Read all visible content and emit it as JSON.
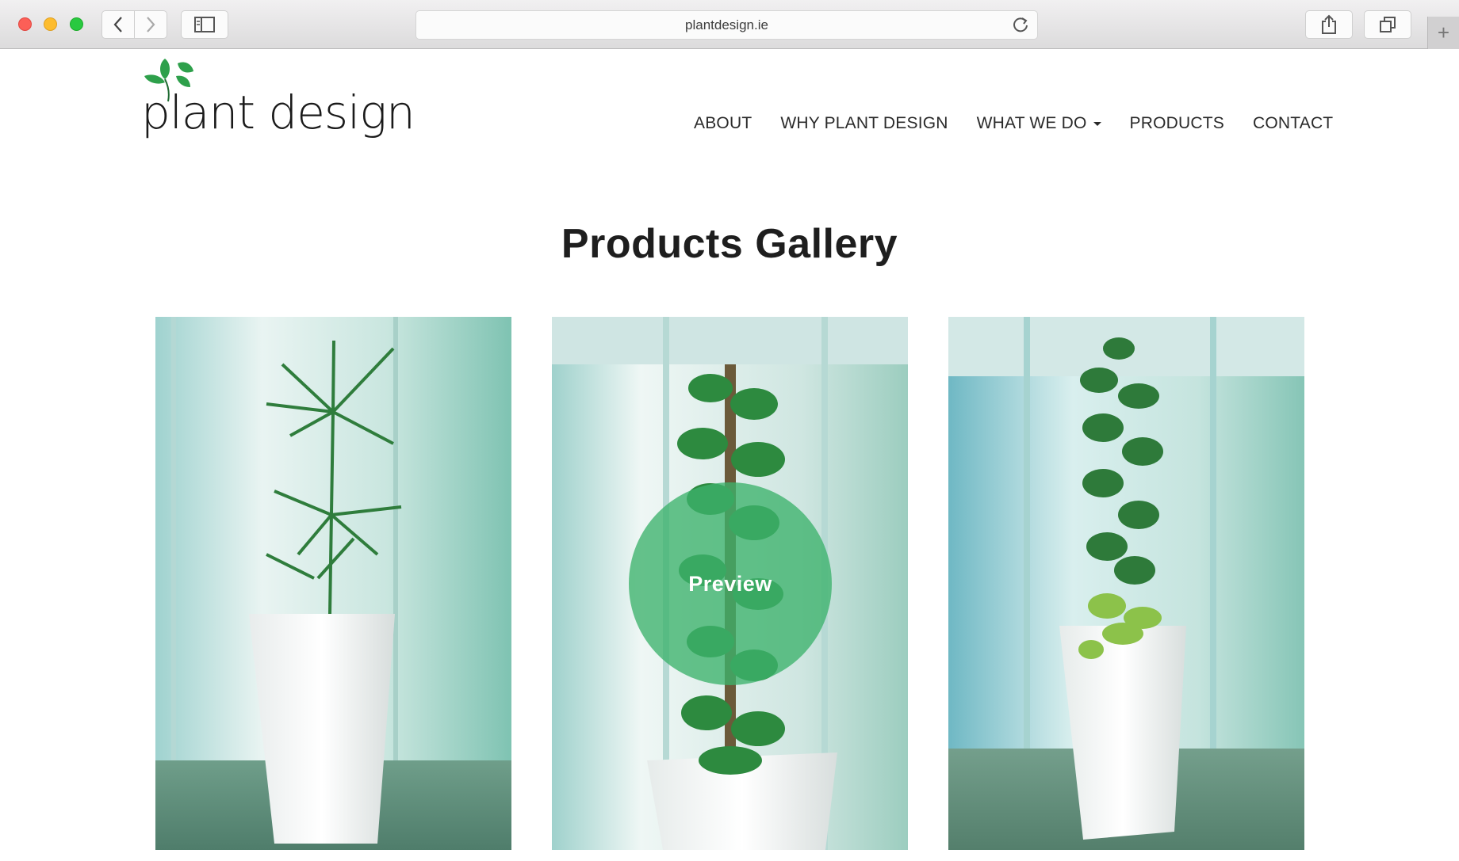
{
  "browser": {
    "url": "plantdesign.ie",
    "icons": {
      "back": "chevron-left-icon",
      "forward": "chevron-right-icon",
      "sidebar": "sidebar-icon",
      "reload": "reload-icon",
      "share": "share-icon",
      "tabs": "tabs-icon",
      "new_tab": "plus-icon"
    }
  },
  "site": {
    "logo_text": "plant design",
    "brand_color": "#2ea04b",
    "nav": [
      {
        "label": "ABOUT"
      },
      {
        "label": "WHY PLANT DESIGN"
      },
      {
        "label": "WHAT WE DO",
        "has_dropdown": true
      },
      {
        "label": "PRODUCTS"
      },
      {
        "label": "CONTACT"
      }
    ]
  },
  "gallery": {
    "title": "Products Gallery",
    "items": [
      {
        "name": "Dracaena in white tapered planter"
      },
      {
        "name": "Climbing pothos on moss pole",
        "overlay_label": "Preview"
      },
      {
        "name": "Tall pothos column in white planter"
      }
    ]
  }
}
